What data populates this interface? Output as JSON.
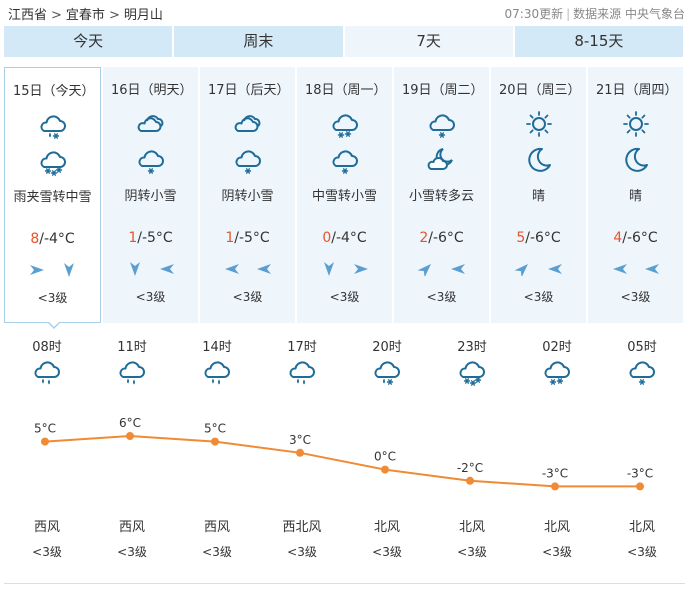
{
  "breadcrumb": {
    "province": "江西省",
    "city": "宜春市",
    "place": "明月山",
    "sep": ">"
  },
  "meta": {
    "updated": "07:30更新",
    "source": "数据来源 中央气象台",
    "divider": "|"
  },
  "tabs": [
    {
      "label": "今天"
    },
    {
      "label": "周末"
    },
    {
      "label": "7天",
      "active": true
    },
    {
      "label": "8-15天"
    }
  ],
  "days": [
    {
      "date": "15日（今天）",
      "icon_day": "rain-snow-icon",
      "icon_night": "heavy-snow-icon",
      "desc": "雨夹雪转中雪",
      "hi": "8",
      "lo": "/-4°C",
      "wind_dirs": [
        "arrow-east-icon",
        "arrow-south-icon"
      ],
      "level": "<3级",
      "selected": true
    },
    {
      "date": "16日（明天）",
      "icon_day": "overcast-icon",
      "icon_night": "light-snow-icon",
      "desc": "阴转小雪",
      "hi": "1",
      "lo": "/-5°C",
      "wind_dirs": [
        "arrow-south-icon",
        "arrow-west-icon"
      ],
      "level": "<3级"
    },
    {
      "date": "17日（后天）",
      "icon_day": "overcast-icon",
      "icon_night": "light-snow-icon",
      "desc": "阴转小雪",
      "hi": "1",
      "lo": "/-5°C",
      "wind_dirs": [
        "arrow-west-icon",
        "arrow-west-icon"
      ],
      "level": "<3级"
    },
    {
      "date": "18日（周一）",
      "icon_day": "moderate-snow-icon",
      "icon_night": "light-snow-icon",
      "desc": "中雪转小雪",
      "hi": "0",
      "lo": "/-4°C",
      "wind_dirs": [
        "arrow-south-icon",
        "arrow-east-icon"
      ],
      "level": "<3级"
    },
    {
      "date": "19日（周二）",
      "icon_day": "light-snow-icon",
      "icon_night": "cloudy-night-icon",
      "desc": "小雪转多云",
      "hi": "2",
      "lo": "/-6°C",
      "wind_dirs": [
        "arrow-northeast-icon",
        "arrow-west-icon"
      ],
      "level": "<3级"
    },
    {
      "date": "20日（周三）",
      "icon_day": "sun-icon",
      "icon_night": "moon-icon",
      "desc": "晴",
      "hi": "5",
      "lo": "/-6°C",
      "wind_dirs": [
        "arrow-northeast-icon",
        "arrow-west-icon"
      ],
      "level": "<3级"
    },
    {
      "date": "21日（周四）",
      "icon_day": "sun-icon",
      "icon_night": "moon-icon",
      "desc": "晴",
      "hi": "4",
      "lo": "/-6°C",
      "wind_dirs": [
        "arrow-west-icon",
        "arrow-west-icon"
      ],
      "level": "<3级"
    }
  ],
  "hourly": [
    {
      "time": "08时",
      "icon": "rain-icon",
      "temp": 5,
      "temp_label": "5°C",
      "wind": "西风",
      "level": "<3级"
    },
    {
      "time": "11时",
      "icon": "rain-icon",
      "temp": 6,
      "temp_label": "6°C",
      "wind": "西风",
      "level": "<3级"
    },
    {
      "time": "14时",
      "icon": "rain-icon",
      "temp": 5,
      "temp_label": "5°C",
      "wind": "西风",
      "level": "<3级"
    },
    {
      "time": "17时",
      "icon": "rain-icon",
      "temp": 3,
      "temp_label": "3°C",
      "wind": "西北风",
      "level": "<3级"
    },
    {
      "time": "20时",
      "icon": "rain-snow-icon",
      "temp": 0,
      "temp_label": "0°C",
      "wind": "北风",
      "level": "<3级"
    },
    {
      "time": "23时",
      "icon": "heavy-snow-icon",
      "temp": -2,
      "temp_label": "-2°C",
      "wind": "北风",
      "level": "<3级"
    },
    {
      "time": "02时",
      "icon": "moderate-snow-icon",
      "temp": -3,
      "temp_label": "-3°C",
      "wind": "北风",
      "level": "<3级"
    },
    {
      "time": "05时",
      "icon": "light-snow-icon",
      "temp": -3,
      "temp_label": "-3°C",
      "wind": "北风",
      "level": "<3级"
    }
  ],
  "colors": {
    "accent": "#f08a35",
    "icon": "#1f6c99",
    "tab_bg": "#d4e9f7",
    "card_bg": "#eef6fc",
    "hi_temp": "#e7542d",
    "arrow": "#5b9fd0"
  }
}
